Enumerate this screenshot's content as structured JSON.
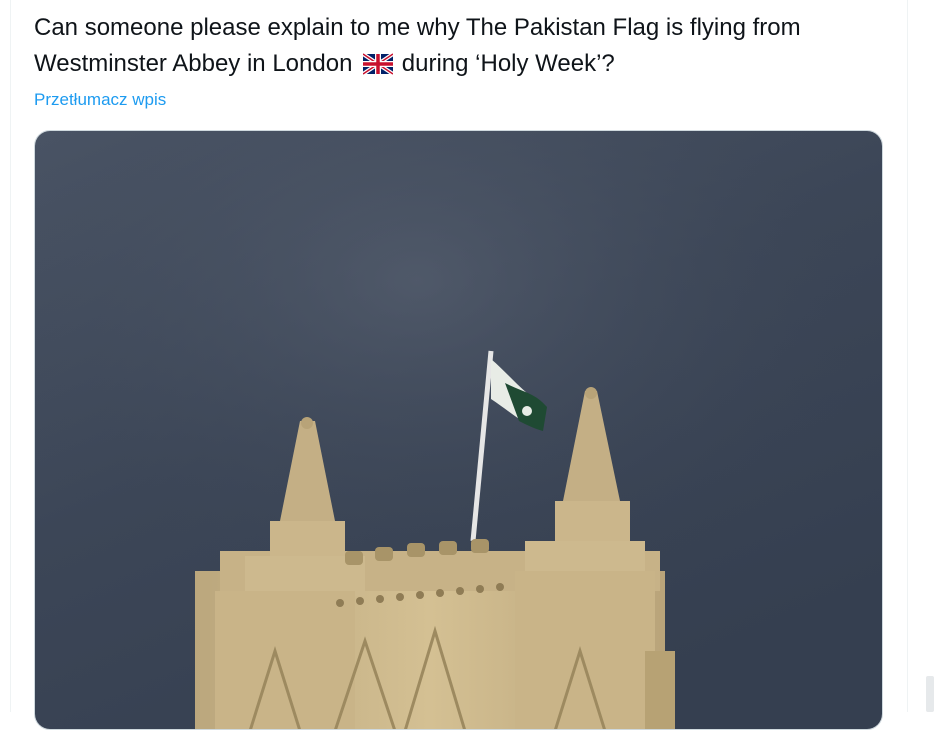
{
  "tweet": {
    "text_before_flag": "Can someone please explain to me why The Pakistan Flag is flying from Westminster Abbey in London",
    "flag_emoji_icon": "uk-flag-icon",
    "text_after_flag": "during ‘Holy Week’?",
    "translate_label": "Przetłumacz wpis"
  },
  "media": {
    "description_icon": "video-thumbnail",
    "sky_color": "#3f4a5a",
    "stone_color": "#c9b48a",
    "flag_green": "#1f4a33"
  },
  "colors": {
    "text": "#0f1419",
    "link": "#1d9bf0",
    "border": "#eff3f4"
  }
}
